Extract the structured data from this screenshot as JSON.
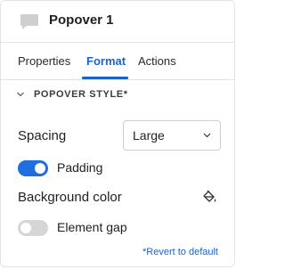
{
  "header": {
    "title": "Popover 1",
    "icon": "message-square-icon"
  },
  "tabs": [
    {
      "label": "Properties",
      "active": false
    },
    {
      "label": "Format",
      "active": true
    },
    {
      "label": "Actions",
      "active": false
    }
  ],
  "section": {
    "title": "POPOVER STYLE*",
    "expanded": true
  },
  "spacing": {
    "label": "Spacing",
    "selected": "Large"
  },
  "padding": {
    "label": "Padding",
    "enabled": true
  },
  "background_color": {
    "label": "Background color",
    "icon": "paint-bucket-icon"
  },
  "element_gap": {
    "label": "Element gap",
    "enabled": false
  },
  "revert_label": "*Revert to default",
  "colors": {
    "accent": "#1c63c9",
    "toggle_on": "#1f6fe0",
    "toggle_off": "#d6d6d6"
  }
}
